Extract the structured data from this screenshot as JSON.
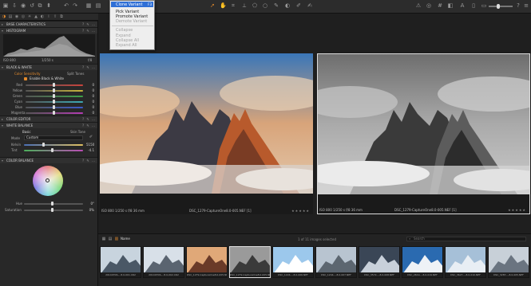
{
  "context_menu": {
    "items": [
      {
        "label": "Clone Variant",
        "shortcut": "F3",
        "highlighted": true,
        "enabled": true
      },
      {
        "label": "Pick Variant",
        "enabled": true
      },
      {
        "label": "Promote Variant",
        "enabled": true
      },
      {
        "label": "Demote Variant",
        "enabled": false
      },
      {
        "label": "Collapse",
        "enabled": false
      },
      {
        "label": "Expand",
        "enabled": false
      },
      {
        "label": "Collapse All",
        "enabled": false
      },
      {
        "label": "Expand All",
        "enabled": false
      }
    ]
  },
  "sidebar": {
    "base_characteristics": "BASE CHARACTERISTICS",
    "histogram": {
      "title": "HISTOGRAM",
      "iso": "ISO 800",
      "shutter": "1/250 s",
      "aperture": "f/8"
    },
    "black_white": {
      "title": "BLACK & WHITE",
      "tab_color": "Color Sensitivity",
      "tab_split": "Split Tones",
      "enable_label": "Enable Black & White",
      "rows": [
        {
          "name": "Red",
          "value": "0",
          "color": "#c8433c"
        },
        {
          "name": "Yellow",
          "value": "0",
          "color": "#c8b43c"
        },
        {
          "name": "Green",
          "value": "0",
          "color": "#3ca048"
        },
        {
          "name": "Cyan",
          "value": "0",
          "color": "#3caab4"
        },
        {
          "name": "Blue",
          "value": "0",
          "color": "#3c5ac8"
        },
        {
          "name": "Magenta",
          "value": "0",
          "color": "#b43cb4"
        }
      ]
    },
    "color_editor": "COLOR EDITOR",
    "white_balance": {
      "title": "WHITE BALANCE",
      "tab_basic": "Basic",
      "tab_skin": "Skin Tone",
      "mode_label": "Mode",
      "mode_value": "Custom",
      "kelvin_label": "Kelvin",
      "kelvin_value": "5150",
      "tint_label": "Tint",
      "tint_value": "-4.1"
    },
    "color_balance": {
      "title": "COLOR BALANCE",
      "hue_label": "Hue",
      "hue_value": "0°",
      "sat_label": "Saturation",
      "sat_value": "0%"
    }
  },
  "viewer": {
    "left": {
      "meta": "ISO 800   1/250 s   f/8   36 mm",
      "filename": "DSC_1279-CaptureOne8.0-005.NEF [1]",
      "stars": "★★★★★"
    },
    "right": {
      "meta": "ISO 800   1/250 s   f/8   36 mm",
      "filename": "DSC_1279-CaptureOne8.0-005.NEF [1]",
      "stars": "★★★★★"
    }
  },
  "browser": {
    "sort_label": "Name",
    "selected_text": "1 of 11 images selected",
    "search_placeholder": "Search",
    "thumbs": [
      "20140706-...8.0-001.CR2",
      "20140706-...8.0-002.CR2",
      "DSC_1279-CaptureOne8.0-005.NEF",
      "DSC_1279-CaptureOne8.0-005.NEF [1]",
      "DSC_1224-...8.0-006.NEF",
      "DSC_1244-...8.0-007.NEF",
      "DSC_3572-...8.0-008.NEF",
      "DSC_2619-...8.0-019.NEF",
      "DSC_3627-...8.0-010.NEF",
      "DSC_3287-...8.0-005.NEF"
    ]
  }
}
